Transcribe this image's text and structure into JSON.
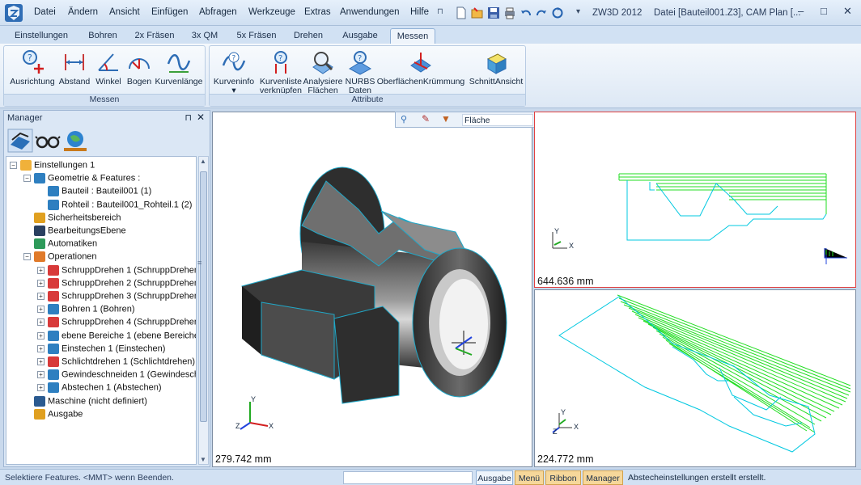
{
  "titlebar": {
    "app_title": "ZW3D 2012",
    "doc_title": "Datei [Bauteil001.Z3],  CAM Plan [...",
    "menu": [
      "Datei",
      "Ändern",
      "Ansicht",
      "Einfügen",
      "Abfragen",
      "Werkzeuge",
      "Extras",
      "Anwendungen",
      "Hilfe"
    ],
    "win_buttons": [
      "–",
      "□",
      "✕"
    ]
  },
  "tabs": [
    "Einstellungen",
    "Bohren",
    "2x Fräsen",
    "3x QM",
    "5x Fräsen",
    "Drehen",
    "Ausgabe",
    "Messen"
  ],
  "active_tab": "Messen",
  "ribbon": {
    "groups": [
      {
        "label": "Messen",
        "buttons": [
          {
            "label": "Ausrichtung",
            "icon": "alignment-icon"
          },
          {
            "label": "Abstand",
            "icon": "distance-icon"
          },
          {
            "label": "Winkel",
            "icon": "angle-icon"
          },
          {
            "label": "Bogen",
            "icon": "arc-icon"
          },
          {
            "label": "Kurvenlänge",
            "icon": "curve-length-icon"
          }
        ]
      },
      {
        "label": "Attribute",
        "buttons": [
          {
            "label": "Kurveninfo",
            "label2": "▾",
            "icon": "curve-info-icon"
          },
          {
            "label": "Kurvenliste",
            "label2": "verknüpfen",
            "icon": "curve-list-icon"
          },
          {
            "label": "Analysiere",
            "label2": "Flächen",
            "icon": "analyze-surface-icon"
          },
          {
            "label": "NURBS",
            "label2": "Daten",
            "icon": "nurbs-icon"
          },
          {
            "label": "OberflächenKrümmung",
            "icon": "surface-curvature-icon"
          },
          {
            "label": "SchnittAnsicht",
            "icon": "section-view-icon"
          }
        ]
      }
    ]
  },
  "manager": {
    "title": "Manager",
    "pin": "⊓",
    "close": "✕",
    "tree": [
      {
        "label": "Einstellungen 1",
        "level": 0,
        "exp": "−",
        "icon": "folder-icon"
      },
      {
        "label": "Geometrie & Features :",
        "level": 1,
        "exp": "−",
        "icon": "geometry-icon"
      },
      {
        "label": "Bauteil : Bauteil001 (1)",
        "level": 2,
        "exp": "",
        "icon": "part-icon"
      },
      {
        "label": "Rohteil : Bauteil001_Rohteil.1 (2)",
        "level": 2,
        "exp": "",
        "icon": "stock-icon"
      },
      {
        "label": "Sicherheitsbereich",
        "level": 1,
        "exp": "",
        "icon": "safety-zone-icon"
      },
      {
        "label": "BearbeitungsEbene",
        "level": 1,
        "exp": "",
        "icon": "machining-plane-icon"
      },
      {
        "label": "Automatiken",
        "level": 1,
        "exp": "",
        "icon": "automation-icon"
      },
      {
        "label": "Operationen",
        "level": 1,
        "exp": "−",
        "icon": "operations-icon"
      },
      {
        "label": "SchruppDrehen 1 (SchruppDrehen",
        "level": 2,
        "exp": "+",
        "icon": "rough-turn-icon"
      },
      {
        "label": "SchruppDrehen 2 (SchruppDrehen",
        "level": 2,
        "exp": "+",
        "icon": "rough-turn-icon"
      },
      {
        "label": "SchruppDrehen 3 (SchruppDrehen",
        "level": 2,
        "exp": "+",
        "icon": "rough-turn-icon"
      },
      {
        "label": "Bohren 1 (Bohren)",
        "level": 2,
        "exp": "+",
        "icon": "drill-icon"
      },
      {
        "label": "SchruppDrehen 4 (SchruppDrehen",
        "level": 2,
        "exp": "+",
        "icon": "rough-turn-icon"
      },
      {
        "label": "ebene Bereiche 1 (ebene Bereiche",
        "level": 2,
        "exp": "+",
        "icon": "flat-area-icon"
      },
      {
        "label": "Einstechen 1 (Einstechen)",
        "level": 2,
        "exp": "+",
        "icon": "groove-icon"
      },
      {
        "label": "Schlichtdrehen 1 (Schlichtdrehen)",
        "level": 2,
        "exp": "+",
        "icon": "finish-turn-icon"
      },
      {
        "label": "Gewindeschneiden 1 (Gewindesch",
        "level": 2,
        "exp": "+",
        "icon": "thread-icon"
      },
      {
        "label": "Abstechen 1 (Abstechen)",
        "level": 2,
        "exp": "+",
        "icon": "partoff-icon"
      },
      {
        "label": "Maschine (nicht definiert)",
        "level": 1,
        "exp": "",
        "icon": "machine-icon"
      },
      {
        "label": "Ausgabe",
        "level": 1,
        "exp": "",
        "icon": "output-icon"
      }
    ]
  },
  "floating_toolbar": {
    "surface_select": "Fläche"
  },
  "viewports": {
    "main_measure": "279.742 mm",
    "top_right_measure": "644.636 mm",
    "bottom_right_measure": "224.772 mm",
    "axis": {
      "x": "X",
      "y": "Y",
      "z": "Z"
    }
  },
  "status": {
    "prompt": "Selektiere Features.  <MMT> wenn Beenden.",
    "tabs": [
      "Ausgabe",
      "Menü",
      "Ribbon",
      "Manager"
    ],
    "message": "Abstecheinstellungen erstellt erstellt."
  },
  "colors": {
    "toolpath": "#22dd22",
    "outline": "#00c8e0",
    "active_view_border": "#e04040"
  }
}
